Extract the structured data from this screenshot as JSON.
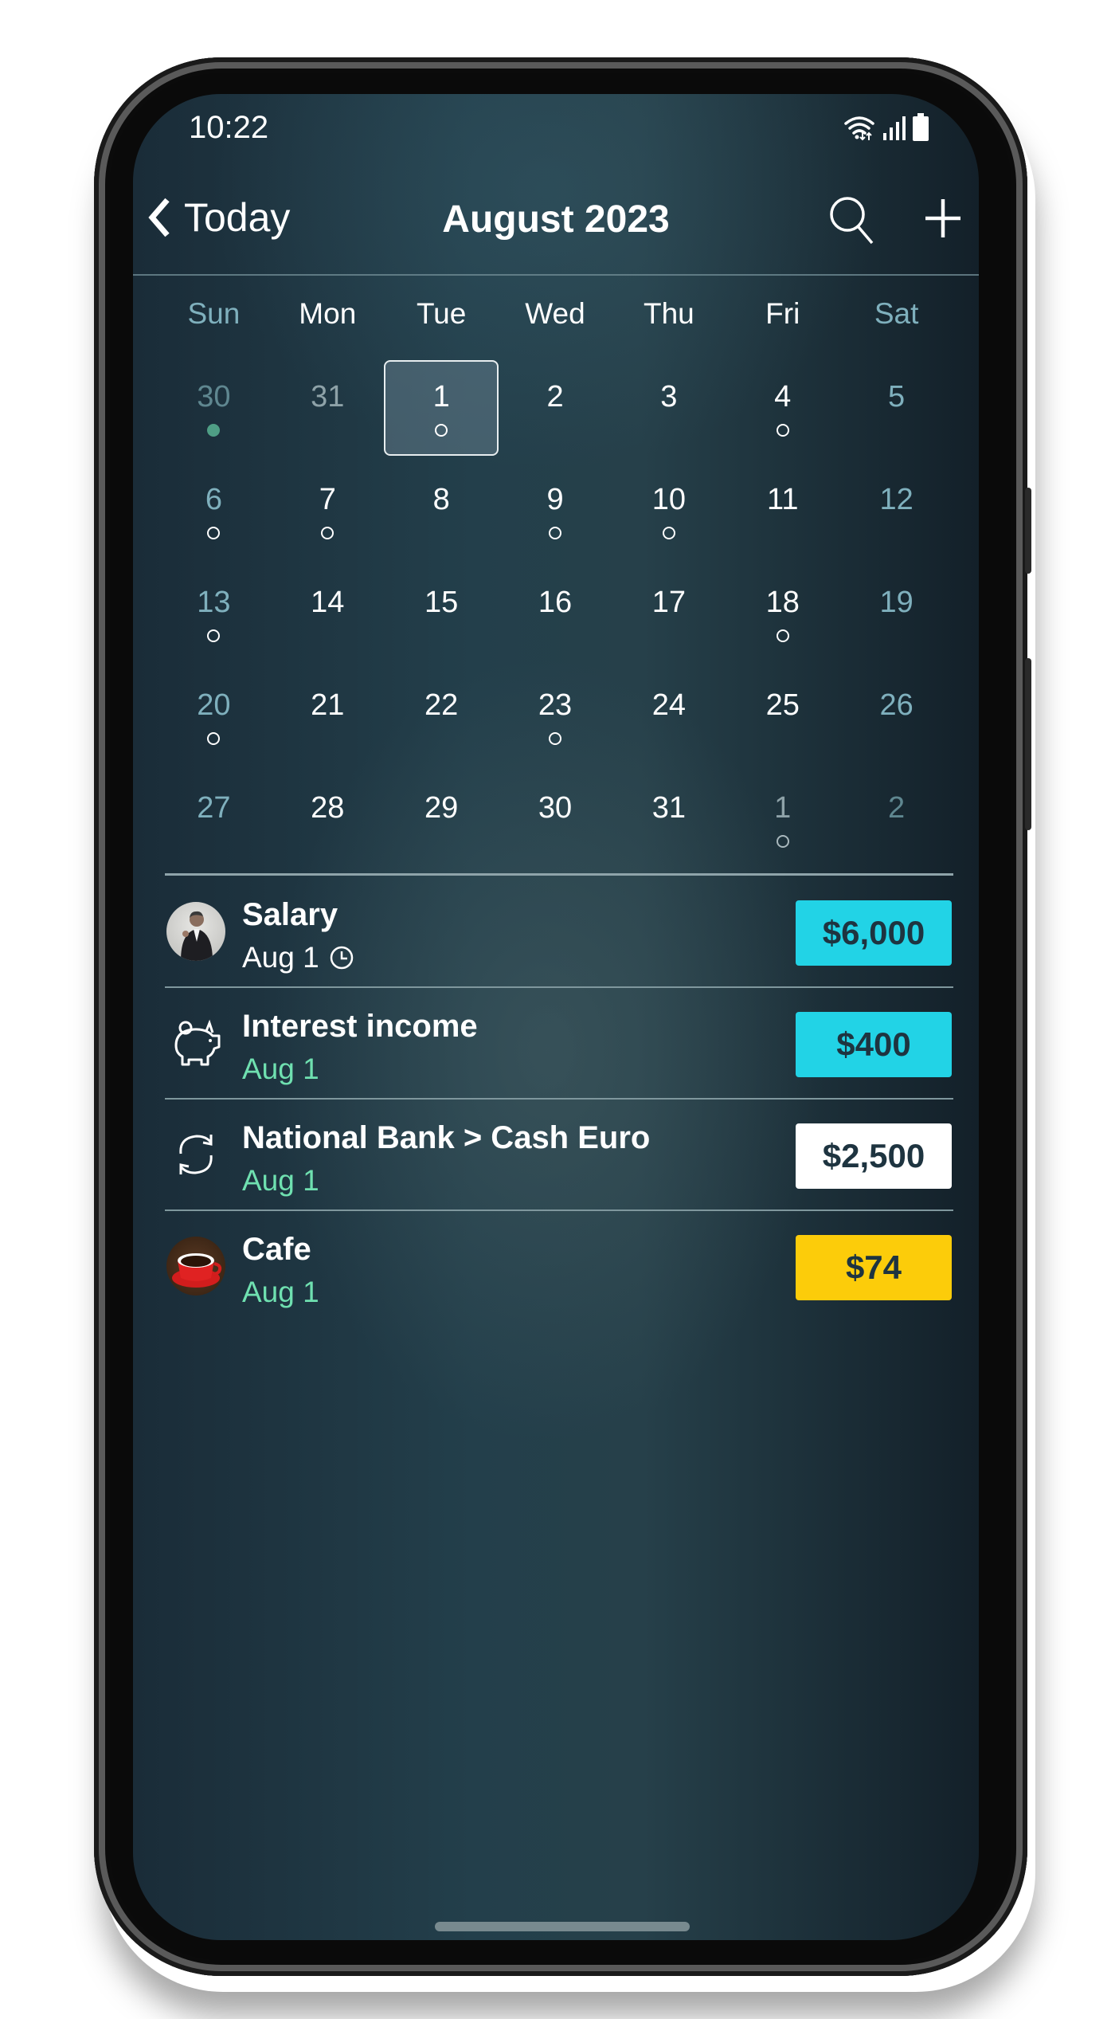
{
  "status_bar": {
    "time": "10:22",
    "icons": [
      "wifi-icon",
      "signal-icon",
      "battery-icon"
    ]
  },
  "header": {
    "back_label": "Today",
    "back_icon": "chevron-left-icon",
    "title": "August 2023",
    "search_icon": "search-icon",
    "add_icon": "plus-icon"
  },
  "calendar": {
    "weekdays": [
      "Sun",
      "Mon",
      "Tue",
      "Wed",
      "Thu",
      "Fri",
      "Sat"
    ],
    "selected_day": "1",
    "weeks": [
      [
        {
          "d": "30",
          "other": true,
          "mark": "filled"
        },
        {
          "d": "31",
          "other": true
        },
        {
          "d": "1",
          "mark": "ring",
          "selected": true
        },
        {
          "d": "2"
        },
        {
          "d": "3"
        },
        {
          "d": "4",
          "mark": "ring"
        },
        {
          "d": "5"
        }
      ],
      [
        {
          "d": "6",
          "mark": "ring"
        },
        {
          "d": "7",
          "mark": "ring"
        },
        {
          "d": "8"
        },
        {
          "d": "9",
          "mark": "ring"
        },
        {
          "d": "10",
          "mark": "ring"
        },
        {
          "d": "11"
        },
        {
          "d": "12"
        }
      ],
      [
        {
          "d": "13",
          "mark": "ring"
        },
        {
          "d": "14"
        },
        {
          "d": "15"
        },
        {
          "d": "16"
        },
        {
          "d": "17"
        },
        {
          "d": "18",
          "mark": "ring"
        },
        {
          "d": "19"
        }
      ],
      [
        {
          "d": "20",
          "mark": "ring"
        },
        {
          "d": "21"
        },
        {
          "d": "22"
        },
        {
          "d": "23",
          "mark": "ring"
        },
        {
          "d": "24"
        },
        {
          "d": "25"
        },
        {
          "d": "26"
        }
      ],
      [
        {
          "d": "27"
        },
        {
          "d": "28"
        },
        {
          "d": "29"
        },
        {
          "d": "30"
        },
        {
          "d": "31"
        },
        {
          "d": "1",
          "other": true,
          "mark": "ring"
        },
        {
          "d": "2",
          "other": true
        }
      ]
    ]
  },
  "transactions": [
    {
      "name": "Salary",
      "date": "Aug 1",
      "scheduled": true,
      "icon": "person-avatar-icon",
      "amount": "$6,000",
      "amount_bg": "#22d3e6",
      "date_color": "#ffffff"
    },
    {
      "name": "Interest income",
      "date": "Aug 1",
      "scheduled": false,
      "icon": "piggy-bank-icon",
      "amount": "$400",
      "amount_bg": "#22d3e6",
      "date_color": "#6fe0b0"
    },
    {
      "name": "National Bank > Cash Euro",
      "date": "Aug 1",
      "scheduled": false,
      "icon": "transfer-icon",
      "amount": "$2,500",
      "amount_bg": "#ffffff",
      "date_color": "#6fe0b0"
    },
    {
      "name": "Cafe",
      "date": "Aug 1",
      "scheduled": false,
      "icon": "coffee-cup-icon",
      "amount": "$74",
      "amount_bg": "#fccc0a",
      "date_color": "#6fe0b0"
    }
  ],
  "colors": {
    "income": "#22d3e6",
    "transfer": "#ffffff",
    "expense": "#fccc0a",
    "weekend": "#7fb0bd",
    "date_green": "#6fe0b0"
  }
}
